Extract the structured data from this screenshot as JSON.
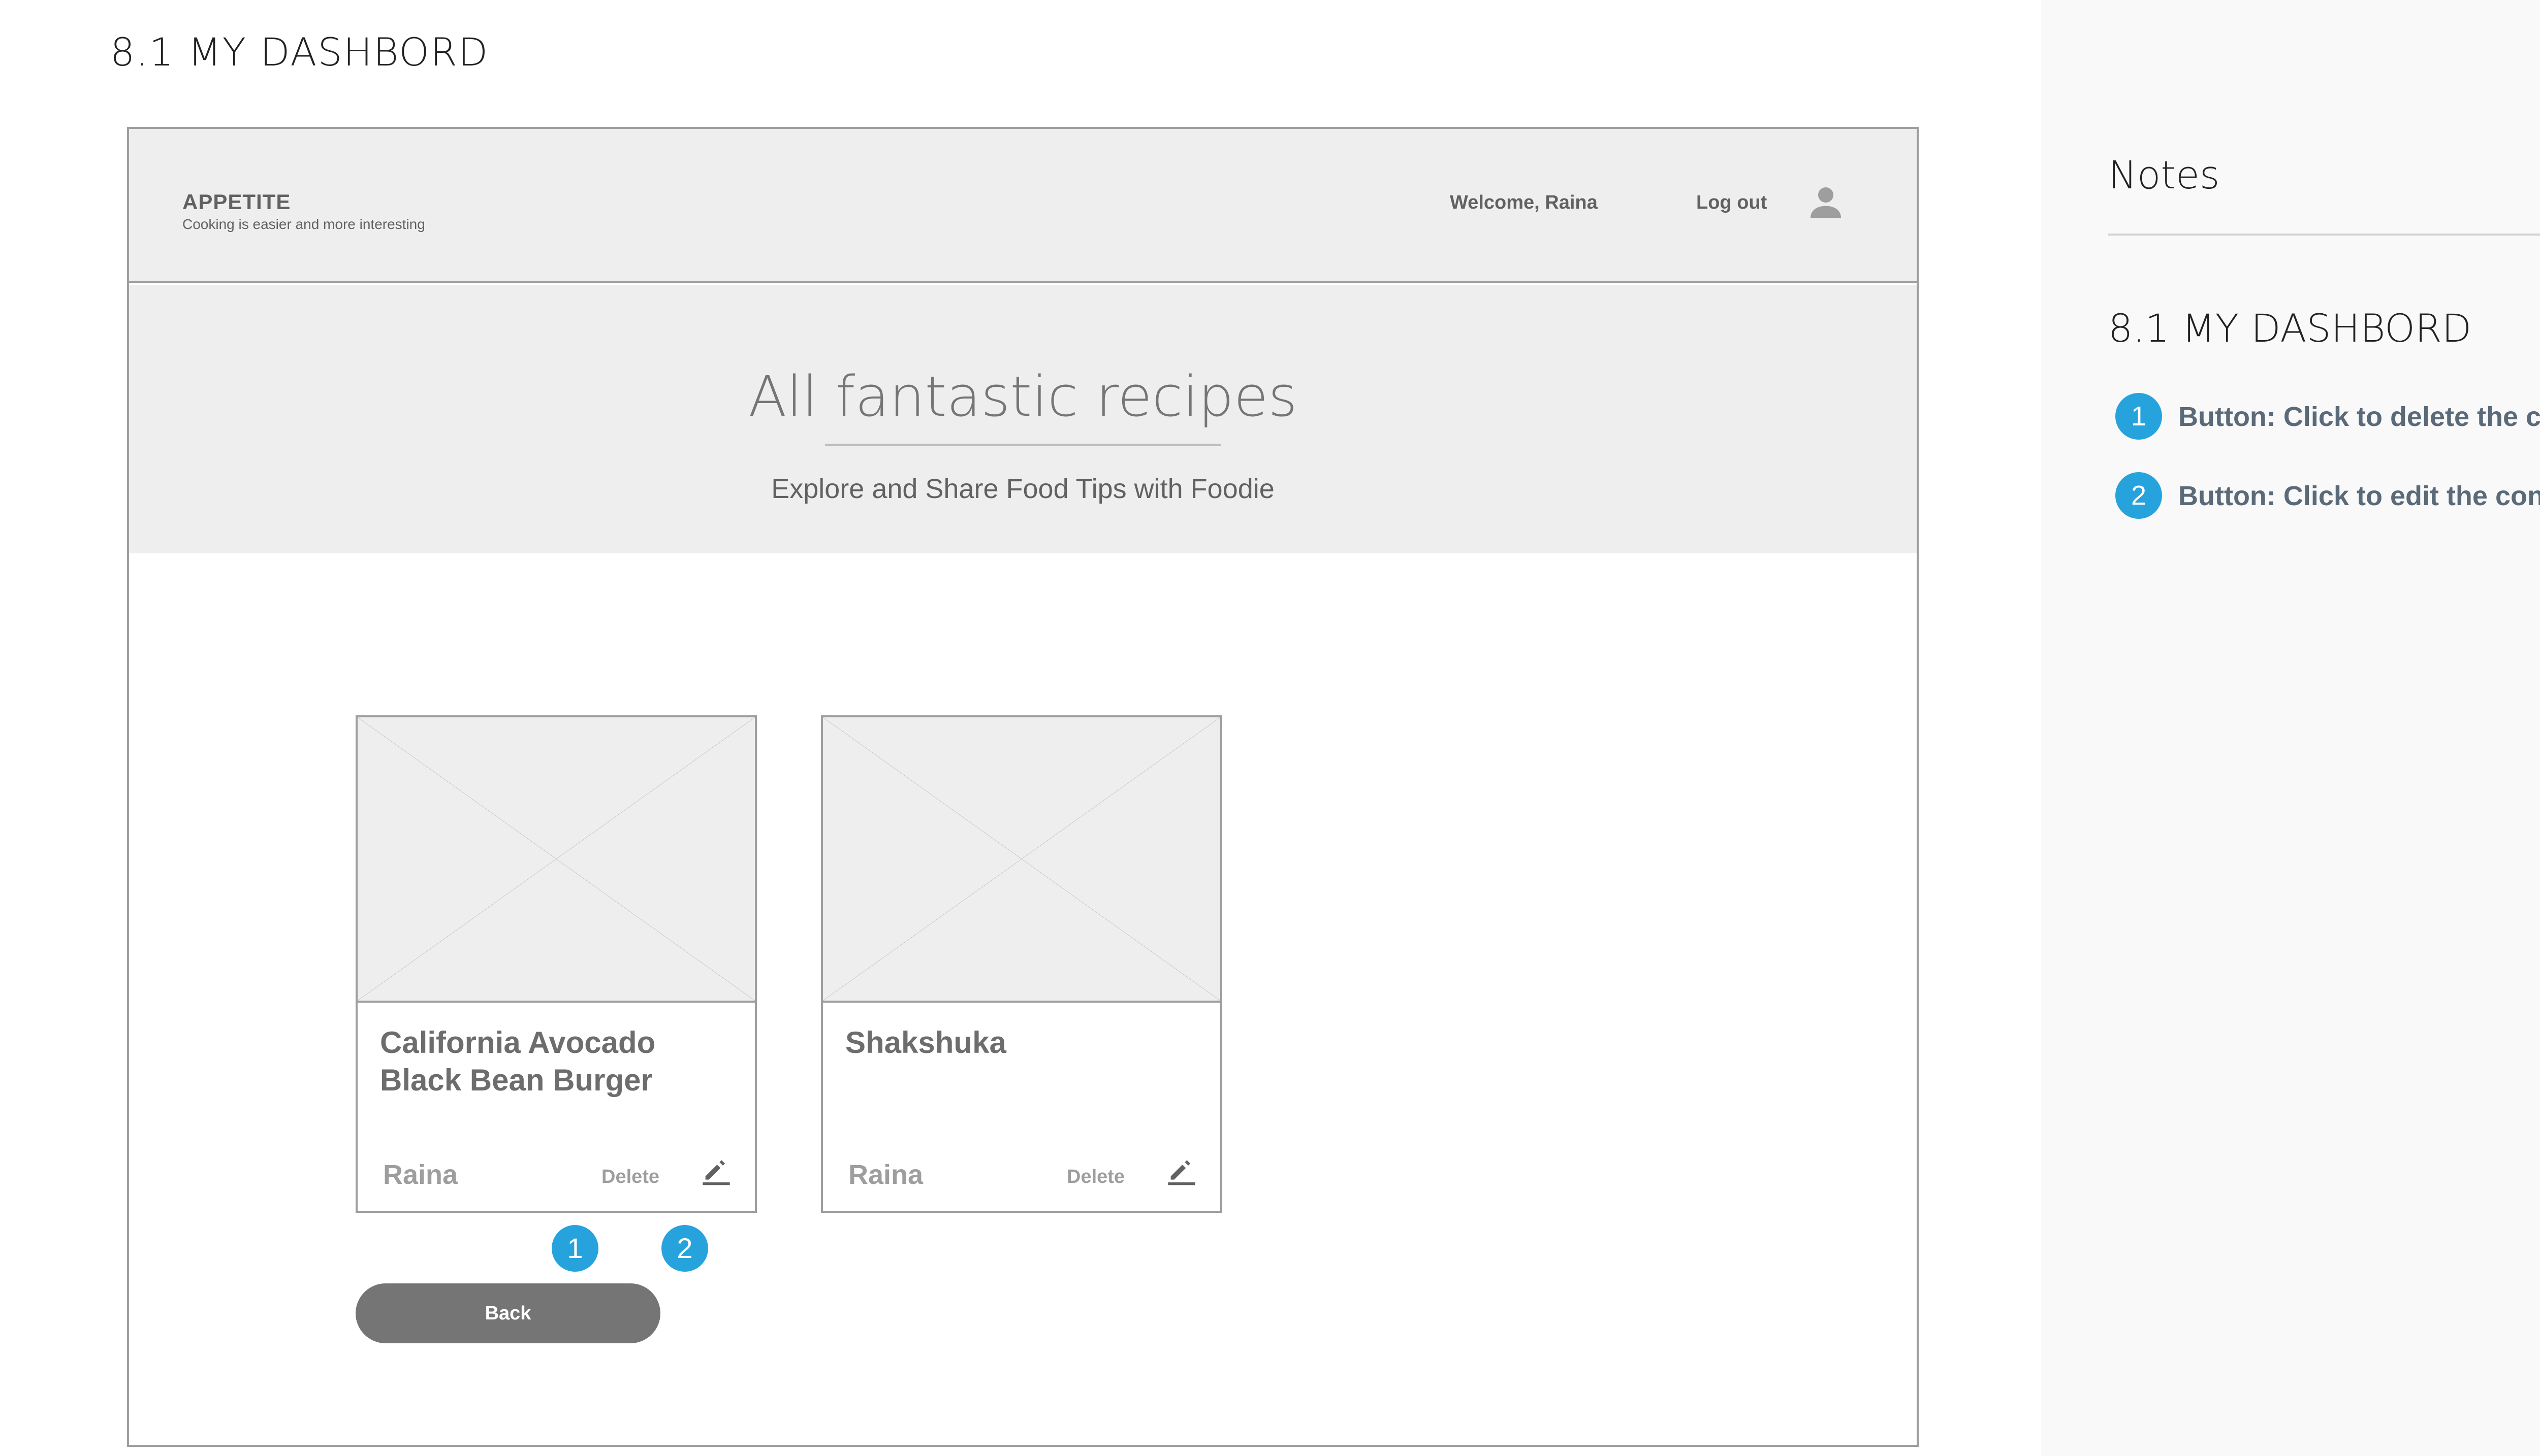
{
  "page": {
    "heading": "8.1  MY DASHBORD"
  },
  "header": {
    "logo_title": "APPETITE",
    "logo_subtitle": "Cooking is easier and more interesting",
    "welcome": "Welcome, Raina",
    "logout_label": "Log out",
    "user_icon": "user-icon"
  },
  "hero": {
    "title": "All fantastic recipes",
    "subtitle": "Explore and Share Food Tips with Foodie"
  },
  "cards": [
    {
      "title": "California Avocado Black Bean Burger",
      "author": "Raina",
      "delete_label": "Delete",
      "edit_icon": "pencil-icon",
      "image_icon": "image-placeholder"
    },
    {
      "title": "Shakshuka",
      "author": "Raina",
      "delete_label": "Delete",
      "edit_icon": "pencil-icon",
      "image_icon": "image-placeholder"
    }
  ],
  "markers": [
    "1",
    "2"
  ],
  "back_button": {
    "label": "Back"
  },
  "notes": {
    "title": "Notes",
    "section": "8.1 MY DASHBORD",
    "items": [
      {
        "number": "1",
        "text": "Button: Click to delete the content"
      },
      {
        "number": "2",
        "text": "Button: Click to edit the content"
      }
    ]
  },
  "colors": {
    "accent": "#26a3dd",
    "header_bg": "#eeeeee",
    "button_bg": "#757575",
    "border": "#9e9e9e"
  }
}
